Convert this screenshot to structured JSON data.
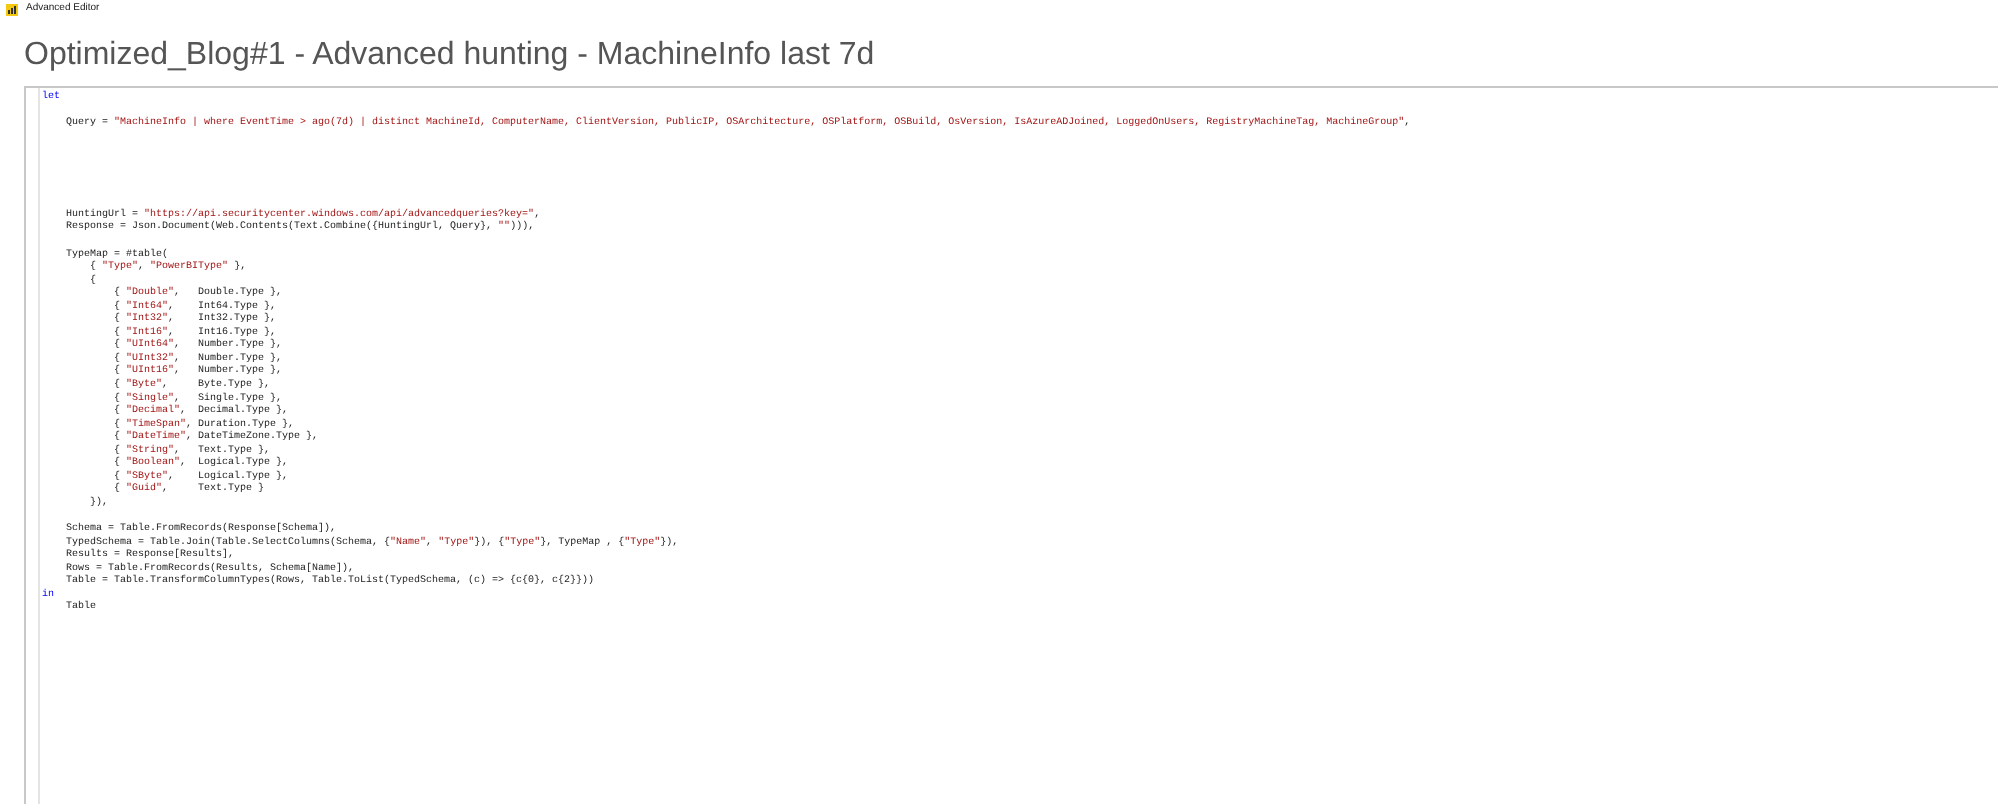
{
  "window": {
    "title": "Advanced Editor"
  },
  "query_title": "Optimized_Blog#1 - Advanced hunting - MachineInfo last 7d",
  "code_lines": [
    {
      "kind": "code",
      "segments": [
        {
          "kind": "keyword",
          "text": "let"
        }
      ]
    },
    {
      "kind": "blank"
    },
    {
      "kind": "code",
      "segments": [
        {
          "kind": "plain",
          "text": "    Query = "
        },
        {
          "kind": "string",
          "text": "\"MachineInfo | where EventTime > ago(7d) | distinct MachineId, ComputerName, ClientVersion, PublicIP, OSArchitecture, OSPlatform, OSBuild, OsVersion, IsAzureADJoined, LoggedOnUsers, RegistryMachineTag, MachineGroup\""
        },
        {
          "kind": "plain",
          "text": ","
        }
      ]
    },
    {
      "kind": "blank"
    },
    {
      "kind": "blank"
    },
    {
      "kind": "blank"
    },
    {
      "kind": "blank"
    },
    {
      "kind": "blank"
    },
    {
      "kind": "blank"
    },
    {
      "kind": "code",
      "segments": [
        {
          "kind": "plain",
          "text": "    HuntingUrl = "
        },
        {
          "kind": "string",
          "text": "\"https://api.securitycenter.windows.com/api/advancedqueries?key=\""
        },
        {
          "kind": "plain",
          "text": ","
        }
      ]
    },
    {
      "kind": "code",
      "segments": [
        {
          "kind": "plain",
          "text": "    Response = Json.Document(Web.Contents(Text.Combine({HuntingUrl, Query}, "
        },
        {
          "kind": "string",
          "text": "\"\""
        },
        {
          "kind": "plain",
          "text": "))),"
        }
      ]
    },
    {
      "kind": "blank"
    },
    {
      "kind": "code",
      "segments": [
        {
          "kind": "plain",
          "text": "    TypeMap = #table("
        }
      ]
    },
    {
      "kind": "code",
      "segments": [
        {
          "kind": "plain",
          "text": "        { "
        },
        {
          "kind": "string",
          "text": "\"Type\""
        },
        {
          "kind": "plain",
          "text": ", "
        },
        {
          "kind": "string",
          "text": "\"PowerBIType\""
        },
        {
          "kind": "plain",
          "text": " },"
        }
      ]
    },
    {
      "kind": "code",
      "segments": [
        {
          "kind": "plain",
          "text": "        {"
        }
      ]
    },
    {
      "kind": "code",
      "segments": [
        {
          "kind": "plain",
          "text": "            { "
        },
        {
          "kind": "string",
          "text": "\"Double\""
        },
        {
          "kind": "plain",
          "text": ",   Double.Type },"
        }
      ]
    },
    {
      "kind": "code",
      "segments": [
        {
          "kind": "plain",
          "text": "            { "
        },
        {
          "kind": "string",
          "text": "\"Int64\""
        },
        {
          "kind": "plain",
          "text": ",    Int64.Type },"
        }
      ]
    },
    {
      "kind": "code",
      "segments": [
        {
          "kind": "plain",
          "text": "            { "
        },
        {
          "kind": "string",
          "text": "\"Int32\""
        },
        {
          "kind": "plain",
          "text": ",    Int32.Type },"
        }
      ]
    },
    {
      "kind": "code",
      "segments": [
        {
          "kind": "plain",
          "text": "            { "
        },
        {
          "kind": "string",
          "text": "\"Int16\""
        },
        {
          "kind": "plain",
          "text": ",    Int16.Type },"
        }
      ]
    },
    {
      "kind": "code",
      "segments": [
        {
          "kind": "plain",
          "text": "            { "
        },
        {
          "kind": "string",
          "text": "\"UInt64\""
        },
        {
          "kind": "plain",
          "text": ",   Number.Type },"
        }
      ]
    },
    {
      "kind": "code",
      "segments": [
        {
          "kind": "plain",
          "text": "            { "
        },
        {
          "kind": "string",
          "text": "\"UInt32\""
        },
        {
          "kind": "plain",
          "text": ",   Number.Type },"
        }
      ]
    },
    {
      "kind": "code",
      "segments": [
        {
          "kind": "plain",
          "text": "            { "
        },
        {
          "kind": "string",
          "text": "\"UInt16\""
        },
        {
          "kind": "plain",
          "text": ",   Number.Type },"
        }
      ]
    },
    {
      "kind": "code",
      "segments": [
        {
          "kind": "plain",
          "text": "            { "
        },
        {
          "kind": "string",
          "text": "\"Byte\""
        },
        {
          "kind": "plain",
          "text": ",     Byte.Type },"
        }
      ]
    },
    {
      "kind": "code",
      "segments": [
        {
          "kind": "plain",
          "text": "            { "
        },
        {
          "kind": "string",
          "text": "\"Single\""
        },
        {
          "kind": "plain",
          "text": ",   Single.Type },"
        }
      ]
    },
    {
      "kind": "code",
      "segments": [
        {
          "kind": "plain",
          "text": "            { "
        },
        {
          "kind": "string",
          "text": "\"Decimal\""
        },
        {
          "kind": "plain",
          "text": ",  Decimal.Type },"
        }
      ]
    },
    {
      "kind": "code",
      "segments": [
        {
          "kind": "plain",
          "text": "            { "
        },
        {
          "kind": "string",
          "text": "\"TimeSpan\""
        },
        {
          "kind": "plain",
          "text": ", Duration.Type },"
        }
      ]
    },
    {
      "kind": "code",
      "segments": [
        {
          "kind": "plain",
          "text": "            { "
        },
        {
          "kind": "string",
          "text": "\"DateTime\""
        },
        {
          "kind": "plain",
          "text": ", DateTimeZone.Type },"
        }
      ]
    },
    {
      "kind": "code",
      "segments": [
        {
          "kind": "plain",
          "text": "            { "
        },
        {
          "kind": "string",
          "text": "\"String\""
        },
        {
          "kind": "plain",
          "text": ",   Text.Type },"
        }
      ]
    },
    {
      "kind": "code",
      "segments": [
        {
          "kind": "plain",
          "text": "            { "
        },
        {
          "kind": "string",
          "text": "\"Boolean\""
        },
        {
          "kind": "plain",
          "text": ",  Logical.Type },"
        }
      ]
    },
    {
      "kind": "code",
      "segments": [
        {
          "kind": "plain",
          "text": "            { "
        },
        {
          "kind": "string",
          "text": "\"SByte\""
        },
        {
          "kind": "plain",
          "text": ",    Logical.Type },"
        }
      ]
    },
    {
      "kind": "code",
      "segments": [
        {
          "kind": "plain",
          "text": "            { "
        },
        {
          "kind": "string",
          "text": "\"Guid\""
        },
        {
          "kind": "plain",
          "text": ",     Text.Type }"
        }
      ]
    },
    {
      "kind": "code",
      "segments": [
        {
          "kind": "plain",
          "text": "        }),"
        }
      ]
    },
    {
      "kind": "blank"
    },
    {
      "kind": "code",
      "segments": [
        {
          "kind": "plain",
          "text": "    Schema = Table.FromRecords(Response[Schema]),"
        }
      ]
    },
    {
      "kind": "code",
      "segments": [
        {
          "kind": "plain",
          "text": "    TypedSchema = Table.Join(Table.SelectColumns(Schema, {"
        },
        {
          "kind": "string",
          "text": "\"Name\""
        },
        {
          "kind": "plain",
          "text": ", "
        },
        {
          "kind": "string",
          "text": "\"Type\""
        },
        {
          "kind": "plain",
          "text": "}), {"
        },
        {
          "kind": "string",
          "text": "\"Type\""
        },
        {
          "kind": "plain",
          "text": "}, TypeMap , {"
        },
        {
          "kind": "string",
          "text": "\"Type\""
        },
        {
          "kind": "plain",
          "text": "}),"
        }
      ]
    },
    {
      "kind": "code",
      "segments": [
        {
          "kind": "plain",
          "text": "    Results = Response[Results],"
        }
      ]
    },
    {
      "kind": "code",
      "segments": [
        {
          "kind": "plain",
          "text": "    Rows = Table.FromRecords(Results, Schema[Name]),"
        }
      ]
    },
    {
      "kind": "code",
      "segments": [
        {
          "kind": "plain",
          "text": "    Table = Table.TransformColumnTypes(Rows, Table.ToList(TypedSchema, (c) => {c{0}, c{2}}))"
        }
      ]
    },
    {
      "kind": "code",
      "segments": [
        {
          "kind": "keyword",
          "text": "in"
        }
      ]
    },
    {
      "kind": "code",
      "segments": [
        {
          "kind": "plain",
          "text": "    Table"
        }
      ]
    }
  ]
}
